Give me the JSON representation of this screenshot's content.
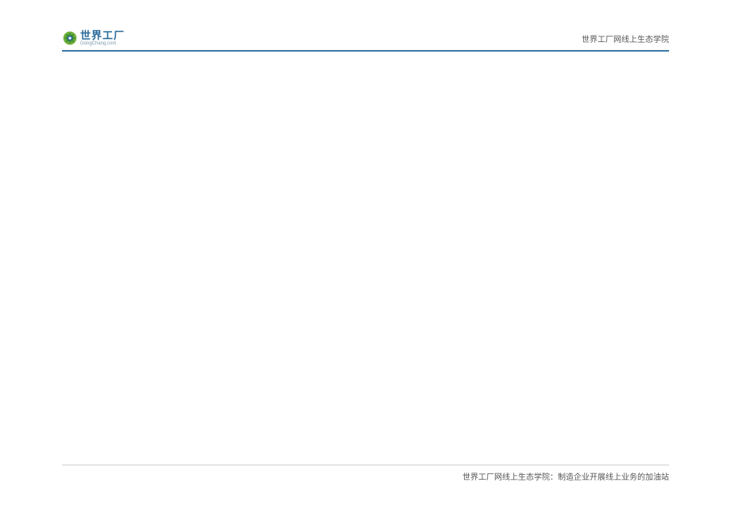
{
  "header": {
    "logo_main": "世界工厂",
    "logo_sub": "GongChang.com",
    "title_right": "世界工厂网线上生态学院"
  },
  "footer": {
    "text": "世界工厂网线上生态学院：制造企业开展线上业务的加油站"
  }
}
